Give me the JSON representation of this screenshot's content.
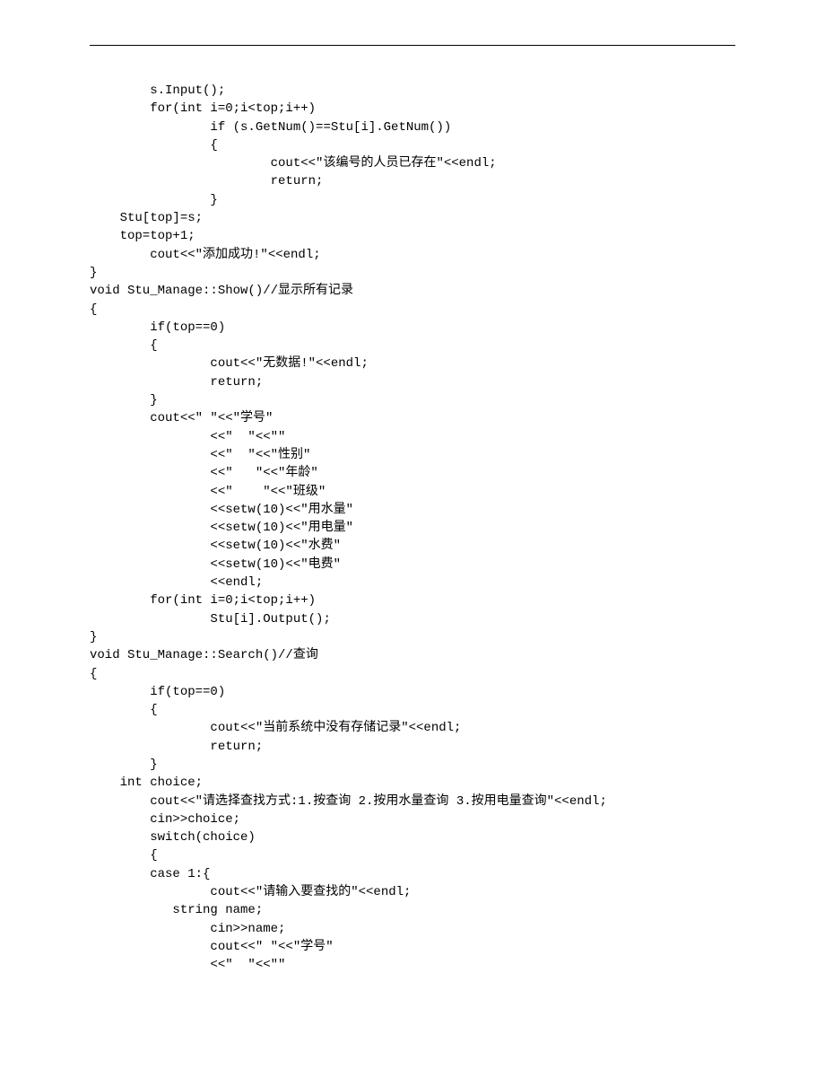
{
  "code": {
    "lines": [
      "        s.Input();",
      "        for(int i=0;i<top;i++)",
      "                if (s.GetNum()==Stu[i].GetNum())",
      "                {",
      "                        cout<<\"该编号的人员已存在\"<<endl;",
      "                        return;",
      "                }",
      "    Stu[top]=s;",
      "    top=top+1;",
      "        cout<<\"添加成功!\"<<endl;",
      "}",
      "void Stu_Manage::Show()//显示所有记录",
      "{",
      "        if(top==0)",
      "        {",
      "                cout<<\"无数据!\"<<endl;",
      "                return;",
      "        }",
      "        cout<<\" \"<<\"学号\"",
      "                <<\"  \"<<\"\"",
      "                <<\"  \"<<\"性别\"",
      "                <<\"   \"<<\"年龄\"",
      "                <<\"    \"<<\"班级\"",
      "                <<setw(10)<<\"用水量\"",
      "                <<setw(10)<<\"用电量\"",
      "                <<setw(10)<<\"水费\"",
      "                <<setw(10)<<\"电费\"",
      "                <<endl;",
      "        for(int i=0;i<top;i++)",
      "                Stu[i].Output();",
      "}",
      "void Stu_Manage::Search()//查询",
      "{",
      "        if(top==0)",
      "        {",
      "                cout<<\"当前系统中没有存储记录\"<<endl;",
      "                return;",
      "        }",
      "    int choice;",
      "        cout<<\"请选择查找方式:1.按查询 2.按用水量查询 3.按用电量查询\"<<endl;",
      "        cin>>choice;",
      "        switch(choice)",
      "        {",
      "        case 1:{",
      "                cout<<\"请输入要查找的\"<<endl;",
      "           string name;",
      "                cin>>name;",
      "                cout<<\" \"<<\"学号\"",
      "                <<\"  \"<<\"\""
    ]
  }
}
